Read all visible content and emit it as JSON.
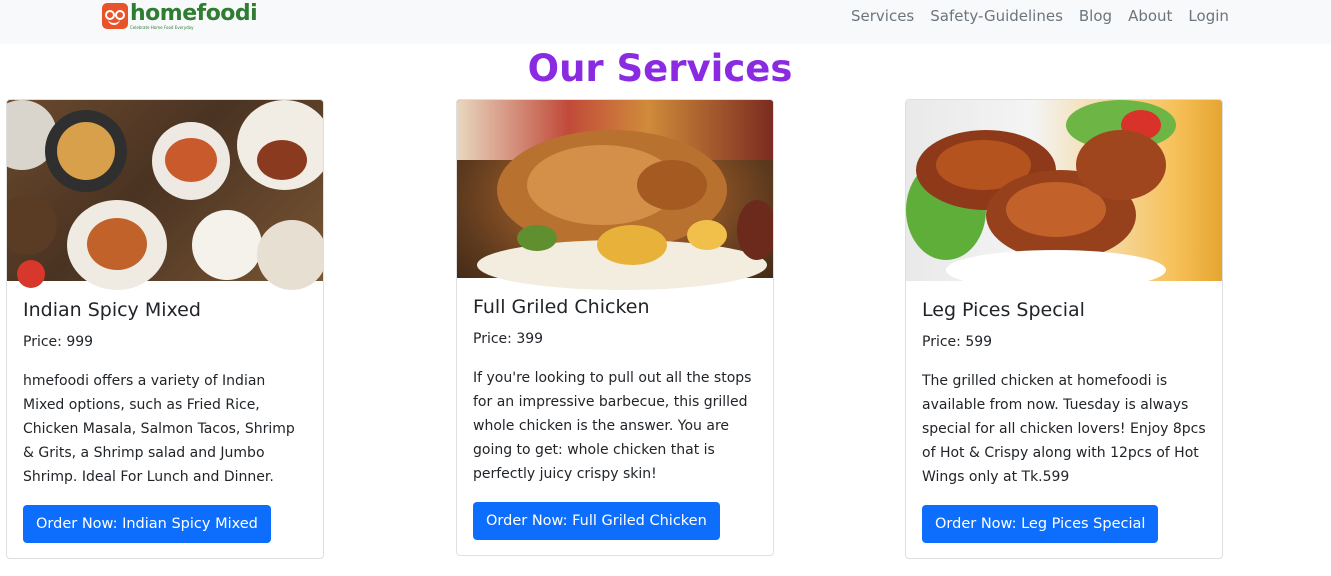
{
  "navbar": {
    "brand_name": "homefoodi",
    "brand_tagline": "Celebrate Home Food Everyday",
    "links": [
      "Services",
      "Safety-Guidelines",
      "Blog",
      "About",
      "Login"
    ]
  },
  "page_title": "Our Services",
  "services": [
    {
      "title": "Indian Spicy Mixed",
      "price": "Price: 999",
      "description": "hmefoodi offers a variety of Indian Mixed options, such as Fried Rice, Chicken Masala, Salmon Tacos, Shrimp & Grits, a Shrimp salad and Jumbo Shrimp. Ideal For Lunch and Dinner.",
      "button": "Order Now: Indian Spicy Mixed"
    },
    {
      "title": "Full Griled Chicken",
      "price": "Price: 399",
      "description": "If you're looking to pull out all the stops for an impressive barbecue, this grilled whole chicken is the answer. You are going to get: whole chicken that is perfectly juicy crispy skin!",
      "button": "Order Now: Full Griled Chicken"
    },
    {
      "title": "Leg Pices Special",
      "price": "Price: 599",
      "description": "The grilled chicken at homefoodi is available from now. Tuesday is always special for all chicken lovers! Enjoy 8pcs of Hot & Crispy along with 12pcs of Hot Wings only at Tk.599",
      "button": "Order Now: Leg Pices Special"
    }
  ],
  "colors": {
    "title": "#8a2be2",
    "button": "#0d6efd",
    "navbar_bg": "#f8f9fa",
    "brand_green": "#2e7d32",
    "brand_orange": "#e8542a"
  }
}
